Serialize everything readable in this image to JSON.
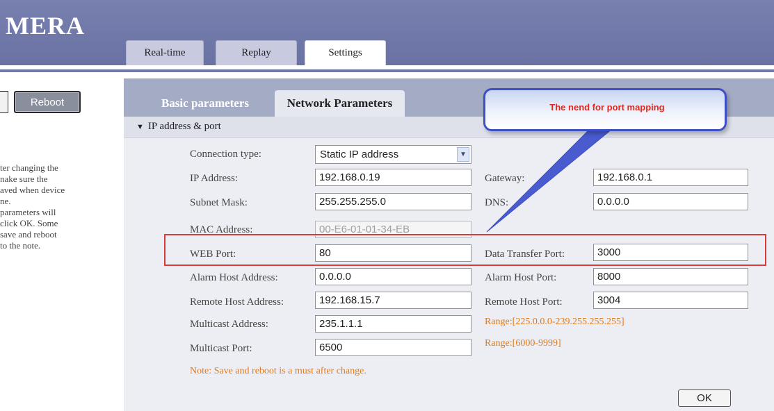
{
  "header": {
    "brand": "MERA",
    "tabs": [
      {
        "label": "Real-time"
      },
      {
        "label": "Replay"
      },
      {
        "label": "Settings"
      }
    ]
  },
  "sidebar": {
    "reboot_label": "Reboot",
    "note_lines": [
      "ter changing the",
      "nake sure the",
      "aved when device",
      "ne.",
      "parameters will",
      "click OK. Some",
      " save and reboot",
      " to the note."
    ]
  },
  "panel": {
    "subtabs": [
      {
        "label": "Basic parameters"
      },
      {
        "label": "Network Parameters"
      }
    ],
    "section_title": "IP address & port",
    "connection_type": {
      "label": "Connection type:",
      "value": "Static IP address"
    },
    "ip_address": {
      "label": "IP Address:",
      "value": "192.168.0.19"
    },
    "gateway": {
      "label": "Gateway:",
      "value": "192.168.0.1"
    },
    "subnet_mask": {
      "label": "Subnet Mask:",
      "value": "255.255.255.0"
    },
    "dns": {
      "label": "DNS:",
      "value": "0.0.0.0"
    },
    "mac_address": {
      "label": "MAC Address:",
      "value": "00-E6-01-01-34-EB"
    },
    "web_port": {
      "label": "WEB Port:",
      "value": "80"
    },
    "data_transfer_port": {
      "label": "Data Transfer Port:",
      "value": "3000"
    },
    "alarm_host_address": {
      "label": "Alarm Host Address:",
      "value": "0.0.0.0"
    },
    "alarm_host_port": {
      "label": "Alarm Host Port:",
      "value": "8000"
    },
    "remote_host_address": {
      "label": "Remote Host Address:",
      "value": "192.168.15.7"
    },
    "remote_host_port": {
      "label": "Remote Host Port:",
      "value": "3004"
    },
    "multicast_address": {
      "label": "Multicast Address:",
      "value": "235.1.1.1",
      "range": "Range:[225.0.0.0-239.255.255.255]"
    },
    "multicast_port": {
      "label": "Multicast Port:",
      "value": "6500",
      "range": "Range:[6000-9999]"
    },
    "note": "Note: Save and reboot is a must after change.",
    "ok_label": "OK"
  },
  "annotation": {
    "callout_text": "The nend for port mapping"
  },
  "colors": {
    "header_bg": "#6f77a8",
    "highlight_border": "#d93a3a",
    "callout_border": "#3c4fc4",
    "callout_text": "#e0281e",
    "range_text": "#e07b1a"
  }
}
